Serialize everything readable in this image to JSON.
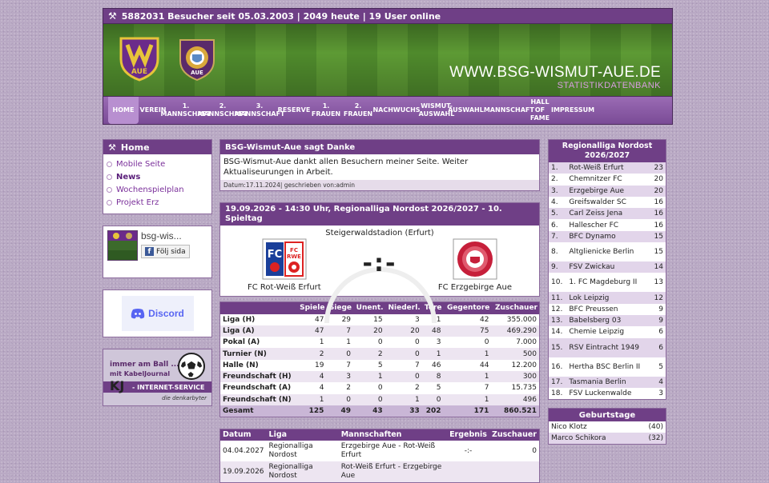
{
  "header": {
    "visitor_line": "5882031 Besucher seit 05.03.2003 | 2049 heute | 19 User online",
    "site_url": "WWW.BSG-WISMUT-AUE.DE",
    "site_sub": "STATISTIKDATENBANK",
    "crest_wismut_text": "AUE",
    "crest_erz_text": "AUE"
  },
  "nav": [
    {
      "label": "HOME",
      "active": true
    },
    {
      "label": "VEREIN"
    },
    {
      "label": "1.\nMANNSCHAFT"
    },
    {
      "label": "2.\nMANNSCHAFT"
    },
    {
      "label": "3.\nMANNSCHAFT"
    },
    {
      "label": "RESERVE"
    },
    {
      "label": "1.\nFRAUEN"
    },
    {
      "label": "2.\nFRAUEN"
    },
    {
      "label": "NACHWUCHS"
    },
    {
      "label": "WISMUT-\nAUSWAHL"
    },
    {
      "label": "AUSWAHLMANNSCHAFT"
    },
    {
      "label": "HALL\nOF\nFAME"
    },
    {
      "label": "IMPRESSUM"
    }
  ],
  "left": {
    "menu_title": "Home",
    "menu_items": [
      {
        "label": "Mobile Seite"
      },
      {
        "label": "News",
        "bold": true
      },
      {
        "label": "Wochenspielplan"
      },
      {
        "label": "Projekt Erz"
      }
    ],
    "fb_name": "bsg-wis...",
    "fb_follow": "Följ sida",
    "fb_f": "f",
    "discord_label": "Discord",
    "kabel_line1": "immer am Ball ...",
    "kabel_line2": "mit KabelJournal",
    "kabel_bar": "- INTERNET-SERVICE",
    "kabel_logo": "KJ",
    "kabel_sub": "die denkarbyter"
  },
  "news": {
    "title": "BSG-Wismut-Aue sagt Danke",
    "text": "BSG-Wismut-Aue dankt allen Besuchern meiner Seite. Weiter Aktualiseurungen in Arbeit.",
    "meta": "Datum:17.11.2024| geschrieben von:admin"
  },
  "match": {
    "title": "19.09.2026 - 14:30 Uhr,  Regionalliga Nordost 2026/2027 - 10. Spieltag",
    "stadium": "Steigerwaldstadion (Erfurt)",
    "home": "FC Rot-Weiß Erfurt",
    "away": "FC Erzgebirge Aue",
    "score": "-:-"
  },
  "stats": {
    "headers": [
      "",
      "Spiele",
      "Siege",
      "Unent.",
      "Niederl.",
      "Tore",
      "Gegentore",
      "Zuschauer"
    ],
    "rows": [
      [
        "Liga (H)",
        "47",
        "29",
        "15",
        "3",
        "91",
        "42",
        "355.000"
      ],
      [
        "Liga (A)",
        "47",
        "7",
        "20",
        "20",
        "48",
        "75",
        "469.290"
      ],
      [
        "Pokal (A)",
        "1",
        "1",
        "0",
        "0",
        "3",
        "0",
        "7.000"
      ],
      [
        "Turnier (N)",
        "2",
        "0",
        "2",
        "0",
        "1",
        "1",
        "500"
      ],
      [
        "Halle (N)",
        "19",
        "7",
        "5",
        "7",
        "46",
        "44",
        "12.200"
      ],
      [
        "Freundschaft (H)",
        "4",
        "3",
        "1",
        "0",
        "8",
        "1",
        "300"
      ],
      [
        "Freundschaft (A)",
        "4",
        "2",
        "0",
        "2",
        "5",
        "7",
        "15.735"
      ],
      [
        "Freundschaft (N)",
        "1",
        "0",
        "0",
        "1",
        "0",
        "1",
        "496"
      ],
      [
        "Gesamt",
        "125",
        "49",
        "43",
        "33",
        "202",
        "171",
        "860.521"
      ]
    ]
  },
  "fixtures": {
    "headers": [
      "Datum",
      "Liga",
      "Mannschaften",
      "Ergebnis",
      "Zuschauer"
    ],
    "rows": [
      [
        "04.04.2027",
        "Regionalliga Nordost",
        "Erzgebirge Aue - Rot-Weiß Erfurt",
        "-:-",
        "0"
      ],
      [
        "19.09.2026",
        "Regionalliga Nordost",
        "Rot-Weiß Erfurt - Erzgebirge Aue",
        "",
        ""
      ]
    ]
  },
  "league": {
    "title": "Regionalliga Nordost 2026/2027",
    "rows": [
      [
        "1.",
        "Rot-Weiß Erfurt",
        "23"
      ],
      [
        "2.",
        "Chemnitzer FC",
        "20"
      ],
      [
        "3.",
        "Erzgebirge Aue",
        "20"
      ],
      [
        "4.",
        "Greifswalder SC",
        "16"
      ],
      [
        "5.",
        "Carl Zeiss Jena",
        "16"
      ],
      [
        "6.",
        "Hallescher FC",
        "16"
      ],
      [
        "7.",
        "BFC Dynamo",
        "15"
      ],
      [
        "8.",
        "Altglienicke Berlin",
        "15"
      ],
      [
        "9.",
        "FSV Zwickau",
        "14"
      ],
      [
        "10.",
        "1. FC Magdeburg II",
        "13"
      ],
      [
        "11.",
        "Lok Leipzig",
        "12"
      ],
      [
        "12.",
        "BFC Preussen",
        "9"
      ],
      [
        "13.",
        "Babelsberg 03",
        "9"
      ],
      [
        "14.",
        "Chemie Leipzig",
        "6"
      ],
      [
        "15.",
        "RSV Eintracht 1949",
        "6"
      ],
      [
        "16.",
        "Hertha BSC Berlin II",
        "5"
      ],
      [
        "17.",
        "Tasmania Berlin",
        "4"
      ],
      [
        "18.",
        "FSV Luckenwalde",
        "3"
      ]
    ]
  },
  "birthdays": {
    "title": "Geburtstage",
    "rows": [
      [
        "Nico Klotz",
        "(40)"
      ],
      [
        "Marco Schikora",
        "(32)"
      ]
    ]
  },
  "colors": {
    "accent": "#6f3f86",
    "nav": "#8a5ba4",
    "row_alt": "#ede5f1"
  }
}
